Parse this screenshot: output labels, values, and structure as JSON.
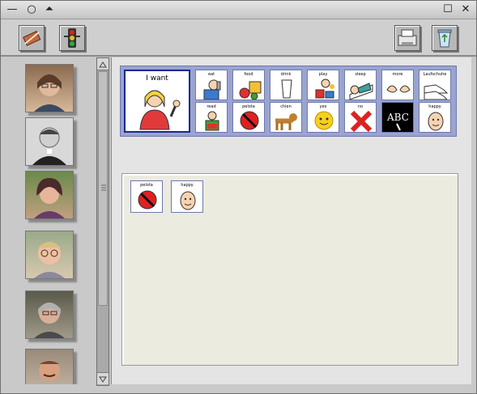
{
  "window": {
    "controls": {
      "minimize": "—",
      "restore": "○",
      "shade": "⏶",
      "maximize": "☐",
      "close": "✕"
    }
  },
  "toolbar": {
    "left_tools": [
      "eraser-icon",
      "traffic-light-icon"
    ],
    "right_tools": [
      "printer-icon",
      "recycle-bin-icon"
    ]
  },
  "people": [
    {
      "name": "woman-with-glasses-photo"
    },
    {
      "name": "man-in-black-photo"
    },
    {
      "name": "woman-with-dark-hair-photo"
    },
    {
      "name": "man-with-glasses-photo"
    },
    {
      "name": "man-with-grey-hair-photo"
    },
    {
      "name": "man-with-mustache-photo"
    }
  ],
  "board": {
    "main_card": {
      "label": "I want"
    },
    "row1": [
      "eat",
      "food",
      "drink",
      "play",
      "sleep",
      "more",
      "Laufschuhe"
    ],
    "row2": [
      "read",
      "pelota",
      "chien",
      "yes",
      "no",
      "",
      "happy"
    ]
  },
  "message": {
    "cards": [
      "pelota",
      "happy"
    ]
  },
  "colors": {
    "board_bg": "#9aa4cf",
    "card_border": "#6f79ad",
    "main_border": "#1a2a8c"
  }
}
